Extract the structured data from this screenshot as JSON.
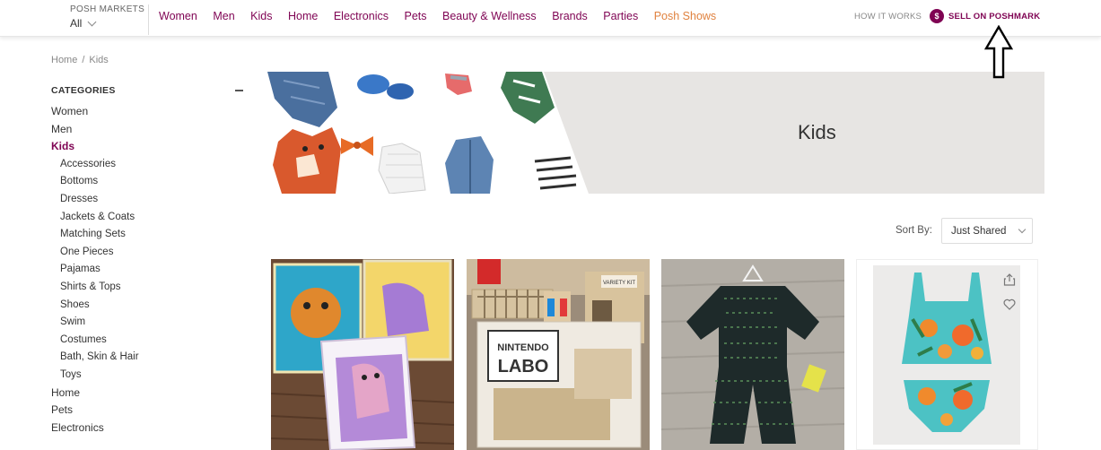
{
  "header": {
    "markets_title": "POSH MARKETS",
    "markets_value": "All",
    "nav": [
      "Women",
      "Men",
      "Kids",
      "Home",
      "Electronics",
      "Pets",
      "Beauty & Wellness",
      "Brands",
      "Parties",
      "Posh Shows"
    ],
    "how_it_works": "HOW IT WORKS",
    "sell_icon_glyph": "$",
    "sell_label": "SELL ON POSHMARK"
  },
  "breadcrumb": {
    "home": "Home",
    "separator": "/",
    "current": "Kids"
  },
  "sidebar": {
    "title": "CATEGORIES",
    "top_items": [
      "Women",
      "Men"
    ],
    "active_item": "Kids",
    "sub_items": [
      "Accessories",
      "Bottoms",
      "Dresses",
      "Jackets & Coats",
      "Matching Sets",
      "One Pieces",
      "Pajamas",
      "Shirts & Tops",
      "Shoes",
      "Swim",
      "Costumes",
      "Bath, Skin & Hair",
      "Toys"
    ],
    "bottom_items": [
      "Home",
      "Pets",
      "Electronics"
    ]
  },
  "banner": {
    "title": "Kids"
  },
  "sort": {
    "label": "Sort By:",
    "selected": "Just Shared"
  },
  "listings": [
    {
      "image": "puzzle-boards-photo"
    },
    {
      "image": "nintendo-labo-box-photo",
      "box_text_1": "NINTENDO",
      "box_text_2": "LABO",
      "box_badge": "VARIETY KIT"
    },
    {
      "image": "pajama-set-photo"
    },
    {
      "image": "floral-swimsuit-photo"
    }
  ],
  "colors": {
    "brand": "#7f0353",
    "accent_orange": "#e0823f",
    "banner_bg": "#e7e5e3"
  },
  "icons": {
    "share": "share-icon",
    "like": "heart-icon",
    "annotation": "up-arrow-icon"
  }
}
